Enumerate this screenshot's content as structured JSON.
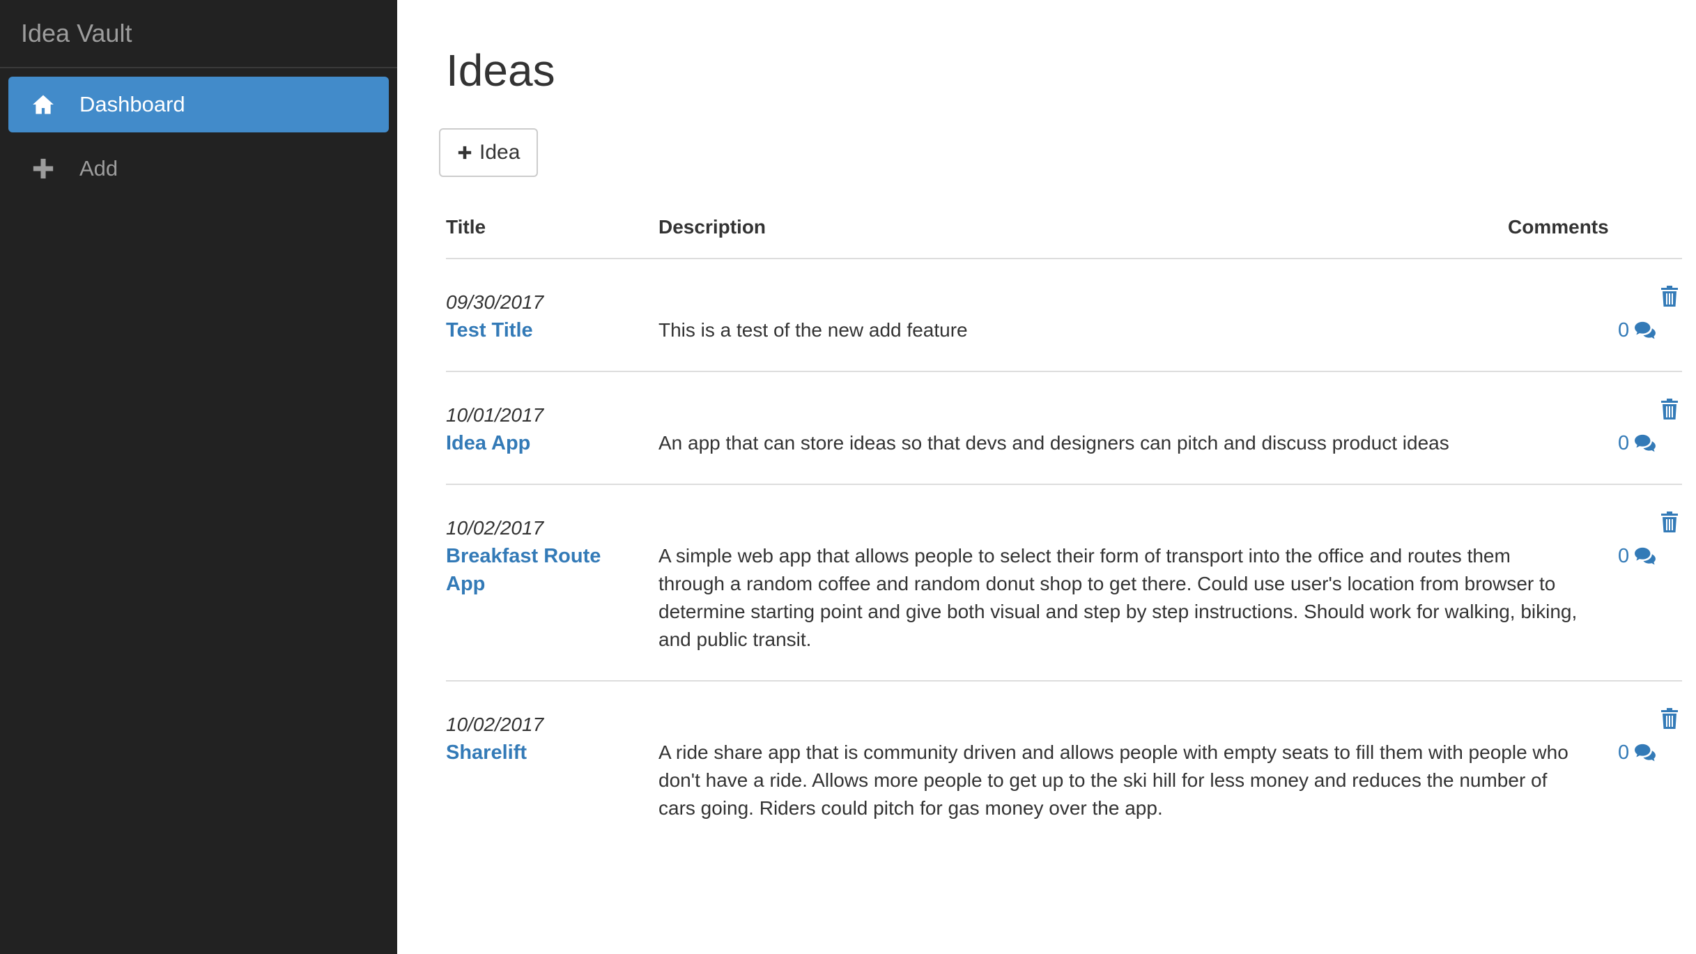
{
  "app": {
    "brand": "Idea Vault"
  },
  "sidebar": {
    "items": [
      {
        "label": "Dashboard",
        "icon": "home-icon",
        "active": true
      },
      {
        "label": "Add",
        "icon": "plus-icon",
        "active": false
      }
    ]
  },
  "main": {
    "title": "Ideas",
    "add_button_label": "Idea",
    "columns": {
      "title": "Title",
      "description": "Description",
      "comments": "Comments"
    },
    "rows": [
      {
        "date": "09/30/2017",
        "title": "Test Title",
        "description": "This is a test of the new add feature",
        "comments": "0"
      },
      {
        "date": "10/01/2017",
        "title": "Idea App",
        "description": "An app that can store ideas so that devs and designers can pitch and discuss product ideas",
        "comments": "0"
      },
      {
        "date": "10/02/2017",
        "title": "Breakfast Route App",
        "description": "A simple web app that allows people to select their form of transport into the office and routes them through a random coffee and random donut shop to get there. Could use user's location from browser to determine starting point and give both visual and step by step instructions. Should work for walking, biking, and public transit.",
        "comments": "0"
      },
      {
        "date": "10/02/2017",
        "title": "Sharelift",
        "description": "A ride share app that is community driven and allows people with empty seats to fill them with people who don't have a ride. Allows more people to get up to the ski hill for less money and reduces the number of cars going. Riders could pitch for gas money over the app.",
        "comments": "0"
      }
    ]
  },
  "colors": {
    "sidebar_bg": "#222222",
    "active_nav": "#428bca",
    "link": "#337ab7",
    "muted_text": "#9d9d9d"
  }
}
